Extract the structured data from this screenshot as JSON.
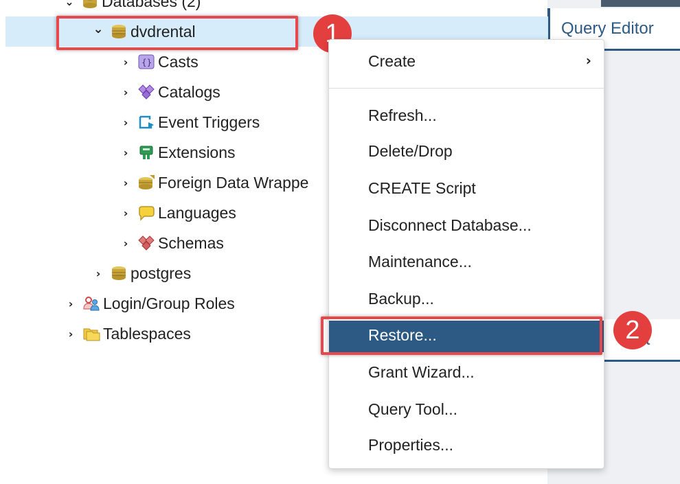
{
  "tree": {
    "databases_label": "Databases (2)",
    "db_selected": "dvdrental",
    "children": [
      {
        "label": "Casts",
        "icon": "casts-icon"
      },
      {
        "label": "Catalogs",
        "icon": "catalogs-icon"
      },
      {
        "label": "Event Triggers",
        "icon": "event-triggers-icon"
      },
      {
        "label": "Extensions",
        "icon": "extensions-icon"
      },
      {
        "label": "Foreign Data Wrappe",
        "icon": "foreign-data-wrappers-icon"
      },
      {
        "label": "Languages",
        "icon": "languages-icon"
      },
      {
        "label": "Schemas",
        "icon": "schemas-icon"
      }
    ],
    "db_other": "postgres",
    "login_roles": "Login/Group Roles",
    "tablespaces": "Tablespaces"
  },
  "tabs": {
    "query_editor": "Query Editor",
    "output_partial": "t"
  },
  "context_menu": {
    "create": "Create",
    "items": [
      "Refresh...",
      "Delete/Drop",
      "CREATE Script",
      "Disconnect Database...",
      "Maintenance...",
      "Backup...",
      "Restore...",
      "Grant Wizard...",
      "Query Tool...",
      "Properties..."
    ],
    "active_index": 6
  },
  "callouts": {
    "step1": "1",
    "step2": "2"
  },
  "colors": {
    "highlight_red": "#e8484c",
    "badge_red": "#e43f3f",
    "menu_active": "#2c5a85",
    "selection_bg": "#d6ecfa"
  }
}
